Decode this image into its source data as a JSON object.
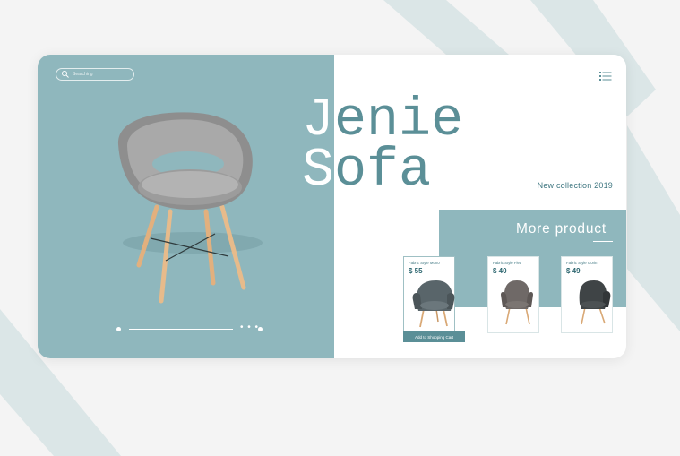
{
  "search": {
    "placeholder": "Searching"
  },
  "hero": {
    "title_line1": [
      "J",
      "e",
      "n",
      "i",
      "e"
    ],
    "title_line2": [
      "S",
      "o",
      "f",
      "a"
    ],
    "subtitle": "New collection 2019"
  },
  "slider": {
    "ellipsis": "• • •"
  },
  "more_products": {
    "title": "More product",
    "items": [
      {
        "name": "Fabric Style Mono",
        "price": "$ 55",
        "cart_label": "Add to Shopping Cart"
      },
      {
        "name": "Fabric Style Flet",
        "price": "$ 40"
      },
      {
        "name": "Fabric Style Gorin",
        "price": "$ 49"
      }
    ]
  },
  "colors": {
    "panel_teal": "#8fb7bd",
    "accent_dark": "#3e7680",
    "button_teal": "#5b8f97",
    "background": "#f4f4f4"
  },
  "icons": [
    "search-icon",
    "menu-list-icon"
  ]
}
